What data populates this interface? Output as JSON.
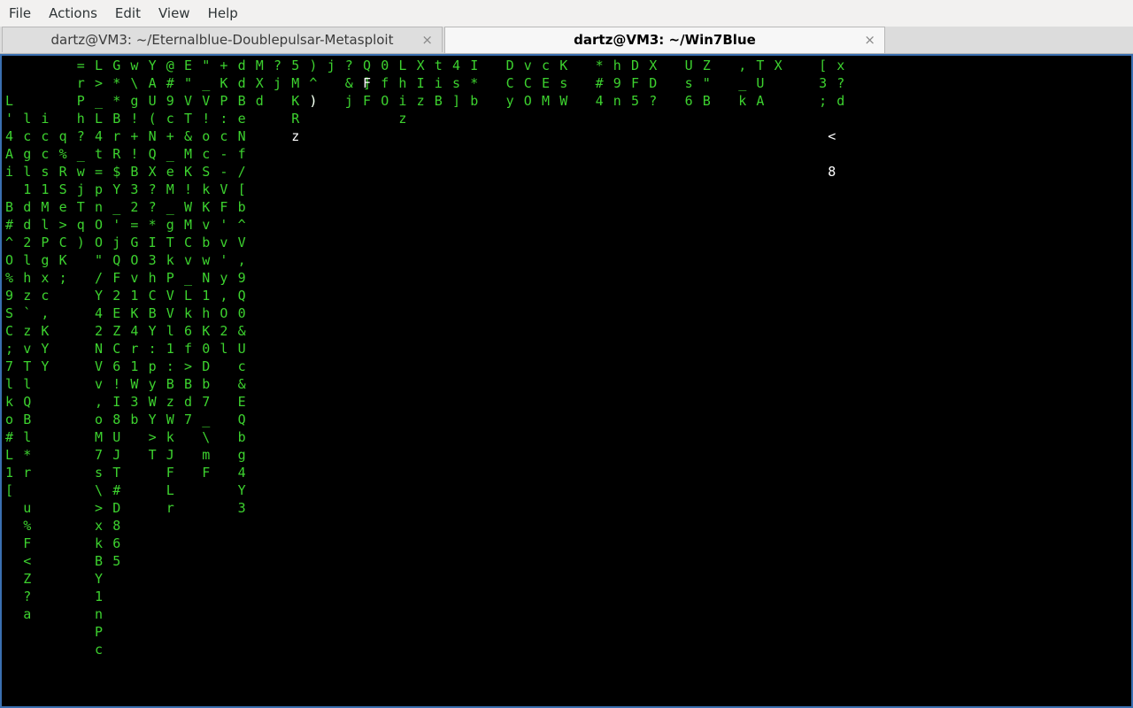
{
  "menubar": {
    "items": [
      "File",
      "Actions",
      "Edit",
      "View",
      "Help"
    ]
  },
  "tabs": [
    {
      "label": "dartz@VM3: ~/Eternalblue-Doublepulsar-Metasploit",
      "active": false
    },
    {
      "label": "dartz@VM3: ~/Win7Blue",
      "active": true
    }
  ],
  "tab_close_glyph": "×",
  "colors": {
    "rain_green": "#3dd22f",
    "rain_head": "#ffffff",
    "terminal_bg": "#000000",
    "focus_border": "#3a6fb0"
  },
  "matrix_columns": [
    {
      "col": 0,
      "chars": "..L'4Ai.B#^O%9SC;7lko#L1["
    },
    {
      "col": 2,
      "chars": "...lcgl1dd2lhz`zvTlQBl*r u%F<Z?a"
    },
    {
      "col": 4,
      "chars": "...iccs1MlPgxc,KYY"
    },
    {
      "col": 6,
      "chars": "....q%RSe>CK;"
    },
    {
      "col": 8,
      "chars": "=rPh?_wjTq)"
    },
    {
      "col": 10,
      "chars": "L>_L4t=pnOO\"/Y42NVv,oM7s\\>xkBY1nPc"
    },
    {
      "col": 12,
      "chars": "G**BrR$Y_'jQF2EZC6!I8UJT#D865"
    },
    {
      "col": 14,
      "chars": "w\\g!+!B32=GOv1K4r1W3b"
    },
    {
      "col": 16,
      "chars": "YAU(NQX??*I3hCBY:pyWY>T"
    },
    {
      "col": 18,
      "chars": "@#9c+_eM_gTkPVVl1:BzWkJFLr"
    },
    {
      "col": 20,
      "chars": "E\"VT&MK!WMCv_Lk6f>Bd7"
    },
    {
      "col": 22,
      "chars": "\"_V!ocSkKvbwN1hK0Db7_\\mF"
    },
    {
      "col": 24,
      "chars": "+KP:c--VF'v'y,O2l"
    },
    {
      "col": 26,
      "chars": "ddBeNf/[b^V,9Q0&Uc&EQbg4Y3"
    },
    {
      "col": 28,
      "chars": "MXd"
    },
    {
      "col": 30,
      "chars": "?j"
    },
    {
      "col": 32,
      "chars": "5MKR"
    },
    {
      "col": 34,
      "chars": ")^)"
    },
    {
      "col": 36,
      "chars": "j"
    },
    {
      "col": 38,
      "chars": "?&j"
    },
    {
      "col": 40,
      "chars": "Q]F"
    },
    {
      "col": 42,
      "chars": "0fO"
    },
    {
      "col": 44,
      "chars": "Lhiz"
    },
    {
      "col": 46,
      "chars": "XIz"
    },
    {
      "col": 48,
      "chars": "tiB"
    },
    {
      "col": 50,
      "chars": "4s]"
    },
    {
      "col": 52,
      "chars": "I*b"
    },
    {
      "col": 56,
      "chars": "DCy"
    },
    {
      "col": 58,
      "chars": "vCO"
    },
    {
      "col": 60,
      "chars": "cEM"
    },
    {
      "col": 62,
      "chars": "KsW"
    },
    {
      "col": 66,
      "chars": "*#4"
    },
    {
      "col": 68,
      "chars": "h9n"
    },
    {
      "col": 70,
      "chars": "DF5"
    },
    {
      "col": 72,
      "chars": "XD?"
    },
    {
      "col": 76,
      "chars": "Us6"
    },
    {
      "col": 78,
      "chars": "Z\"B"
    },
    {
      "col": 82,
      "chars": ",_k"
    },
    {
      "col": 84,
      "chars": "TUA"
    },
    {
      "col": 86,
      "chars": "X"
    },
    {
      "col": 91,
      "chars": "[3;"
    },
    {
      "col": 93,
      "chars": "x?d"
    }
  ],
  "white_glyphs": [
    {
      "col": 40,
      "row": 1,
      "ch": "F"
    },
    {
      "col": 34,
      "row": 2,
      "ch": ")"
    },
    {
      "col": 32,
      "row": 4,
      "ch": "z"
    },
    {
      "col": 92,
      "row": 4,
      "ch": "<"
    },
    {
      "col": 92,
      "row": 6,
      "ch": "8"
    }
  ]
}
